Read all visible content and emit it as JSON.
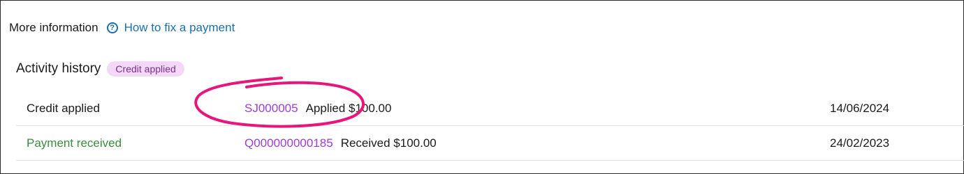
{
  "more_info": {
    "label": "More information",
    "help_icon": "question-circle-icon",
    "link_text": "How to fix a payment"
  },
  "activity": {
    "title": "Activity history",
    "badge": "Credit applied",
    "rows": [
      {
        "type": "Credit applied",
        "reference": "SJ000005",
        "description": "Applied $100.00",
        "date": "14/06/2024"
      },
      {
        "type": "Payment received",
        "reference": "Q000000000185",
        "description": "Received $100.00",
        "date": "24/02/2023"
      }
    ]
  },
  "colors": {
    "link_blue": "#1a6fb0",
    "reference_purple": "#9b3fd1",
    "received_green": "#3d8a3d",
    "badge_bg": "#f3d9f7",
    "badge_text": "#7a2f8c",
    "annotation_pink": "#e8157a"
  }
}
